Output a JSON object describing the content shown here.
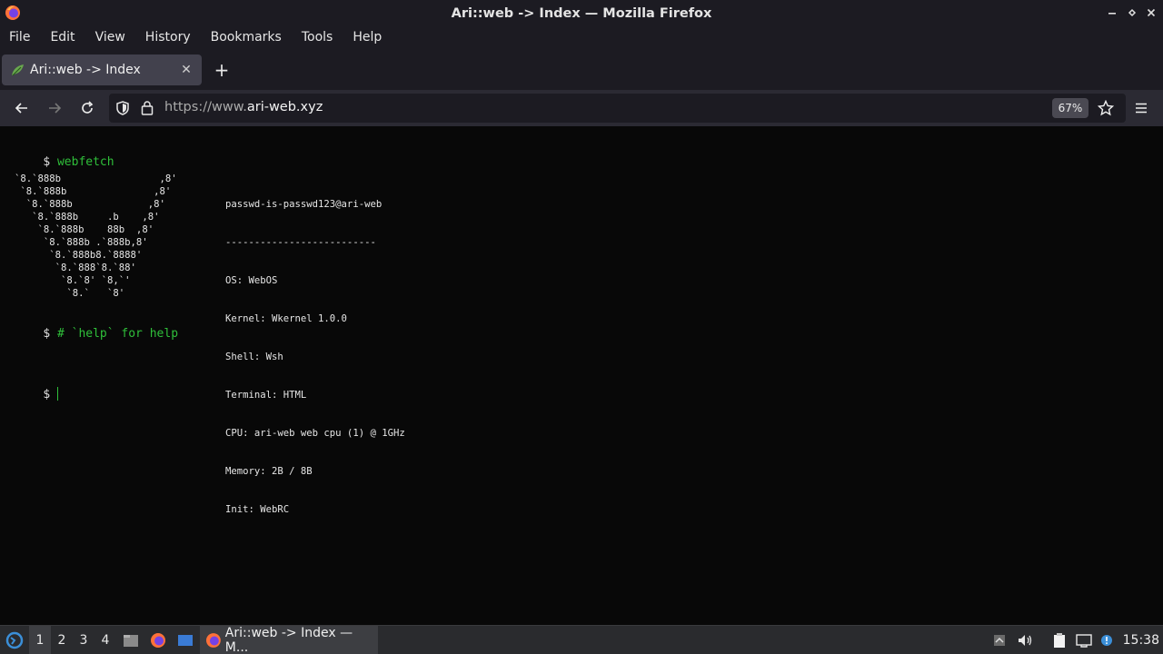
{
  "window": {
    "title": "Ari::web -> Index — Mozilla Firefox",
    "controls": [
      "minimize-icon",
      "restore-icon",
      "close-icon"
    ]
  },
  "menubar": {
    "items": [
      {
        "label": "File"
      },
      {
        "label": "Edit"
      },
      {
        "label": "View"
      },
      {
        "label": "History"
      },
      {
        "label": "Bookmarks"
      },
      {
        "label": "Tools"
      },
      {
        "label": "Help"
      }
    ]
  },
  "tab": {
    "title": "Ari::web -> Index",
    "close": "✕",
    "new_tab": "+"
  },
  "navbar": {
    "url_scheme": "https://www.",
    "url_domain": "ari-web.xyz",
    "zoom": "67%"
  },
  "terminal": {
    "prompt": "$",
    "command1": "webfetch",
    "ascii_art": "`8.`888b                 ,8'\n `8.`888b               ,8'\n  `8.`888b             ,8'\n   `8.`888b     .b    ,8'\n    `8.`888b    88b  ,8'\n     `8.`888b .`888b,8'\n      `8.`888b8.`8888'\n       `8.`888`8.`88'\n        `8.`8' `8,`'\n         `8.`   `8'",
    "info": [
      "passwd-is-passwd123@ari-web",
      "--------------------------",
      "OS: WebOS",
      "Kernel: Wkernel 1.0.0",
      "Shell: Wsh",
      "Terminal: HTML",
      "CPU: ari-web web cpu (1) @ 1GHz",
      "Memory: 2B / 8B",
      "Init: WebRC"
    ],
    "comment": "# `help` for help"
  },
  "taskbar": {
    "workspaces": [
      "1",
      "2",
      "3",
      "4"
    ],
    "task_label": "Ari::web -> Index — M...",
    "clock": "15:38"
  },
  "colors": {
    "prompt_green": "#2fbf3a",
    "chrome_dark": "#1c1b22",
    "toolbar": "#2b2a33"
  }
}
